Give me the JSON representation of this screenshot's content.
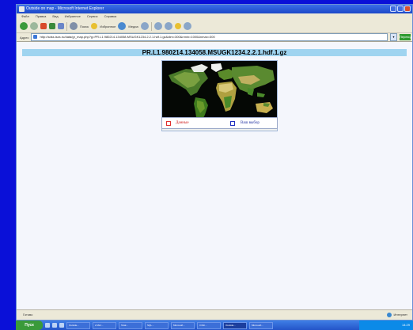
{
  "window": {
    "title": "Outside on map - Microsoft Internet Explorer",
    "menu": [
      "Файл",
      "Правка",
      "Вид",
      "Избранное",
      "Сервис",
      "Справка"
    ]
  },
  "toolbar": {
    "search_label": "Поиск",
    "favorites_label": "Избранное",
    "media_label": "Медиа",
    "icons": [
      "back-icon",
      "forward-icon",
      "stop-icon",
      "refresh-icon",
      "home-icon",
      "search-icon",
      "favorites-icon",
      "media-icon",
      "history-icon",
      "mail-icon",
      "print-icon",
      "edit-icon",
      "discuss-icon"
    ]
  },
  "address": {
    "label": "Адрес",
    "url": "http://sdss.iszs.ru/data/gr_map.php?g=PR.L1.980214.134058.MSUGK1234.2.2.1.hdf.1.gz&dim=300&nmin=1000&nmax=300",
    "go_label": "Переход"
  },
  "page": {
    "file_title": "PR.L1.980214.134058.MSUGK1234.2.2.1.hdf.1.gz",
    "legend": {
      "data_label": "Данные",
      "choice_label": "Ваш выбор",
      "data_color": "#d02020",
      "choice_color": "#2030a0"
    }
  },
  "status": {
    "left": "Готово",
    "zone": "Интернет"
  },
  "taskbar": {
    "start_label": "Пуск",
    "buttons": [
      "Outside...",
      "2 Micr...",
      "Total...",
      "SQL...",
      "Microsoft...",
      "3 Mic...",
      "Outside...",
      "Microsoft..."
    ],
    "active_index": 6,
    "clock": "14:29"
  }
}
